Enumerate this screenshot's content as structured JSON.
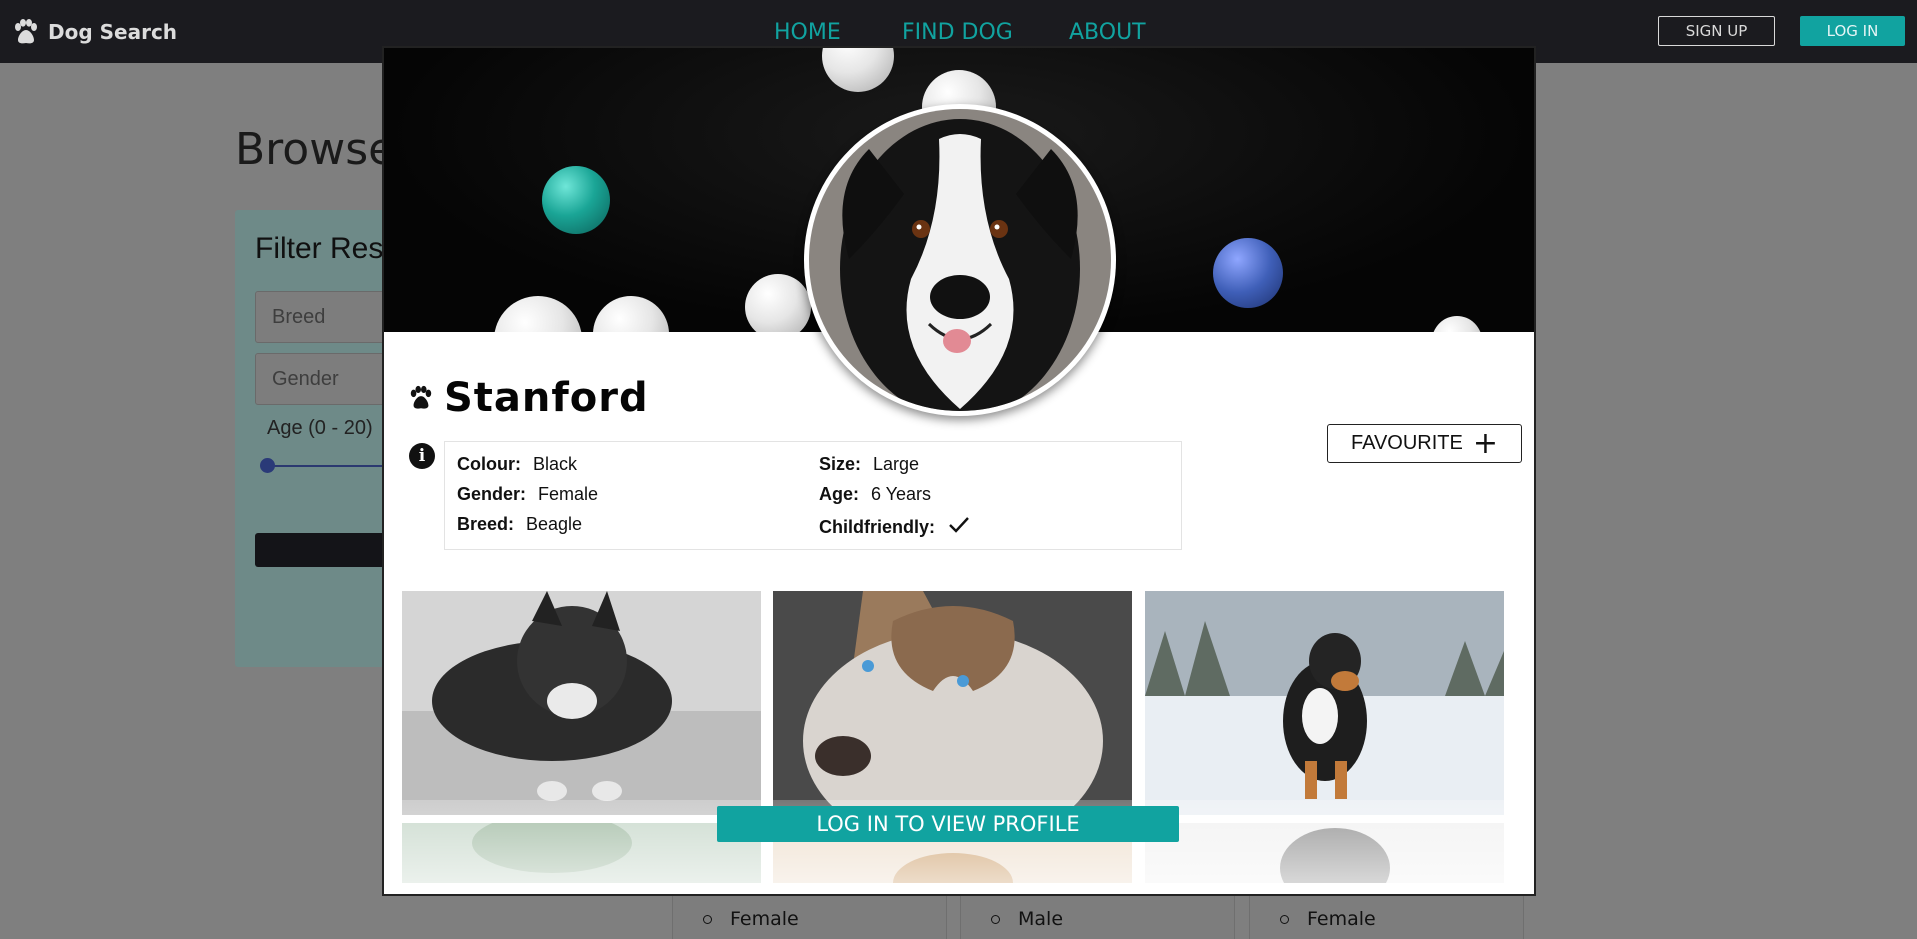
{
  "navbar": {
    "brand": "Dog Search",
    "links": [
      "HOME",
      "FIND DOG",
      "ABOUT"
    ],
    "signup_label": "SIGN UP",
    "login_label": "LOG IN",
    "accent": "#11a3a0"
  },
  "background": {
    "title": "Browse",
    "filter": {
      "title": "Filter Res",
      "breed_placeholder": "Breed",
      "gender_placeholder": "Gender",
      "age_label": "Age (0 - 20)"
    },
    "cards": [
      {
        "item": "Female"
      },
      {
        "item": "Male"
      },
      {
        "item": "Female"
      }
    ]
  },
  "modal": {
    "dog_name": "Stanford",
    "favourite_label": "FAVOURITE",
    "attributes": {
      "colour_key": "Colour:",
      "colour": "Black",
      "gender_key": "Gender:",
      "gender": "Female",
      "breed_key": "Breed:",
      "breed": "Beagle",
      "size_key": "Size:",
      "size": "Large",
      "age_key": "Age:",
      "age": "6 Years",
      "childfriendly_key": "Childfriendly:",
      "childfriendly": true
    },
    "login_to_view_label": "LOG IN TO VIEW PROFILE"
  }
}
